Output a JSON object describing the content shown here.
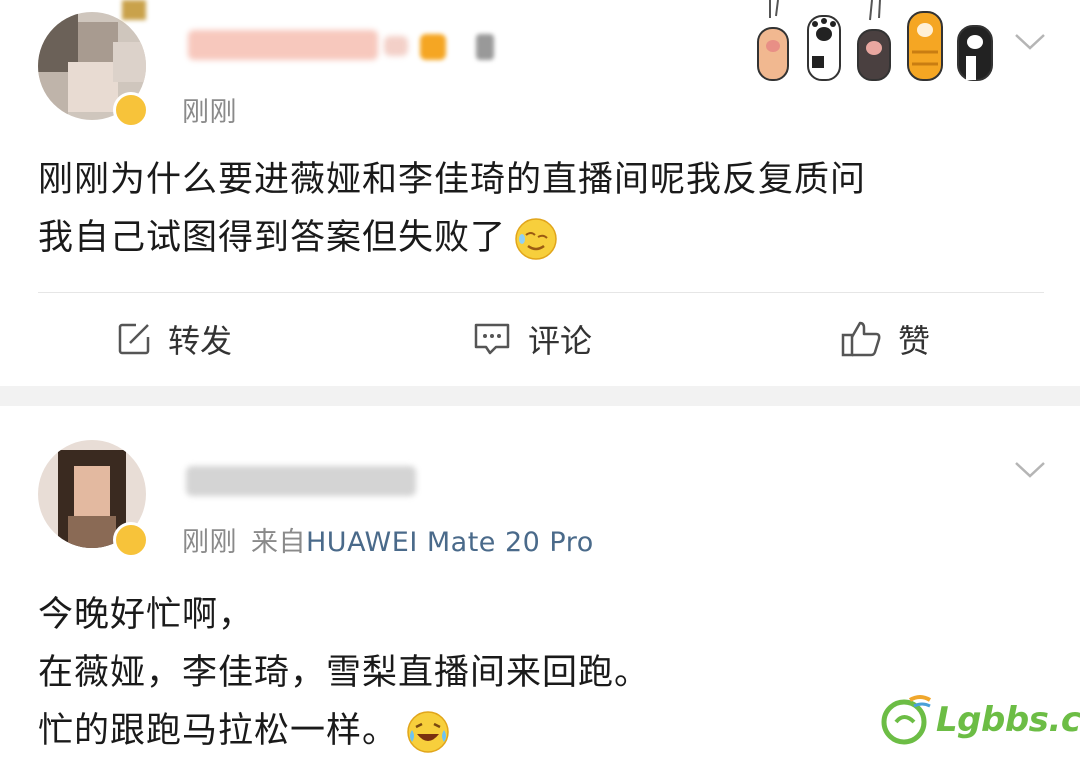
{
  "posts": [
    {
      "time": "刚刚",
      "source": "",
      "text_lines": [
        "刚刚为什么要进薇娅和李佳琦的直播间呢我反复质问",
        "我自己试图得到答案但失败了"
      ],
      "emoji": "sweat-smile-emoji",
      "actions": {
        "repost": "转发",
        "comment": "评论",
        "like": "赞"
      }
    },
    {
      "time": "刚刚",
      "from_label": "来自",
      "source": "HUAWEI Mate 20 Pro",
      "text_lines": [
        "今晚好忙啊，",
        "在薇娅，李佳琦，雪梨直播间来回跑。",
        "忙的跟跑马拉松一样。"
      ],
      "emoji": "laugh-cry-emoji"
    }
  ],
  "watermark": {
    "text": "Lgbbs.cn"
  },
  "colors": {
    "meta": "#8a8a8a",
    "source_link": "#4a6a8a",
    "vip_badge": "#f7c33a",
    "watermark": "#6cbd45",
    "separator": "#f2f2f2"
  }
}
